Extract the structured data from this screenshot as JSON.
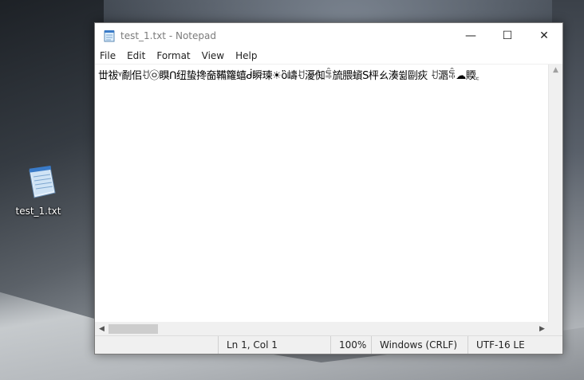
{
  "desktop": {
    "icon_label": "test_1.txt"
  },
  "window": {
    "title": "test_1.txt - Notepad",
    "controls": {
      "minimize": "—",
      "maximize": "☐",
      "close": "✕"
    }
  },
  "menu": {
    "items": [
      {
        "label": "File"
      },
      {
        "label": "Edit"
      },
      {
        "label": "Format"
      },
      {
        "label": "View"
      },
      {
        "label": "Help"
      }
    ]
  },
  "editor": {
    "content": "丗祓ᵞ劀佀ꀀ㉧瞁ᑎ纽蛰搀奤鞴籮蟢ᑰ瞬瑓☀ὃ嶹ꀀ瀀倁ꁃ旈腲蠀Ѕ枰ㄠ湊쓂剾疢 ꀀ滣ꁃ☁䞂꜀"
  },
  "scrollbars": {
    "up_arrow": "▲",
    "left_arrow": "◀",
    "right_arrow": "▶"
  },
  "status": {
    "position": "Ln 1, Col 1",
    "zoom": "100%",
    "line_ending": "Windows (CRLF)",
    "encoding": "UTF-16 LE"
  },
  "icons": {
    "app": "notepad-icon",
    "desktop_file": "notepad-file-icon"
  }
}
